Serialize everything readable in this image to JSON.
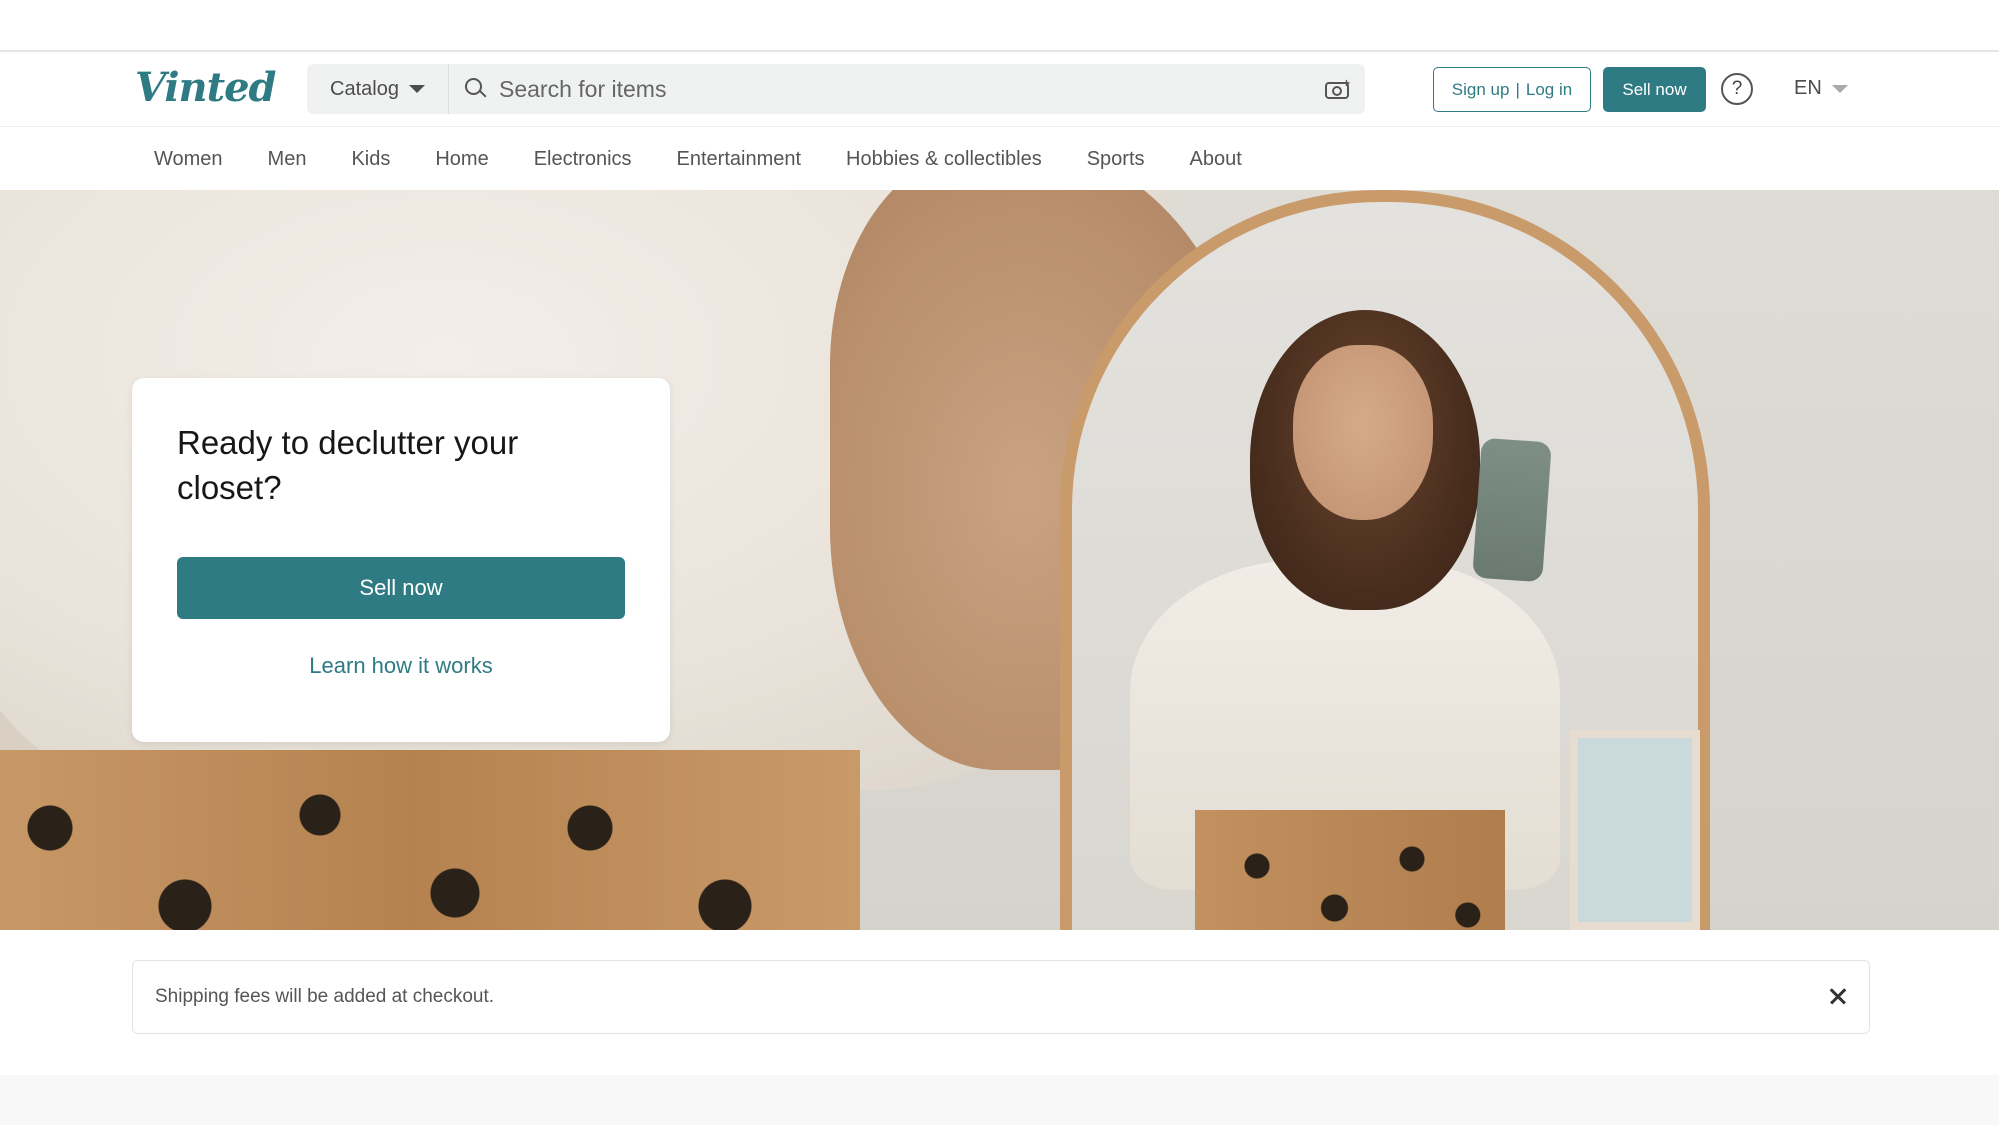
{
  "header": {
    "logo_text": "Vinted",
    "catalog_label": "Catalog",
    "search_placeholder": "Search for items",
    "signup_label": "Sign up",
    "login_label": "Log in",
    "sell_now_label": "Sell now",
    "help_icon": "question-circle-icon",
    "language": "EN"
  },
  "nav": {
    "categories": [
      "Women",
      "Men",
      "Kids",
      "Home",
      "Electronics",
      "Entertainment",
      "Hobbies & collectibles",
      "Sports",
      "About"
    ]
  },
  "hero": {
    "title": "Ready to declutter your closet?",
    "sell_button": "Sell now",
    "learn_link": "Learn how it works"
  },
  "notice": {
    "text": "Shipping fees will be added at checkout.",
    "close_icon": "close-icon"
  },
  "colors": {
    "brand": "#2f7b84"
  }
}
